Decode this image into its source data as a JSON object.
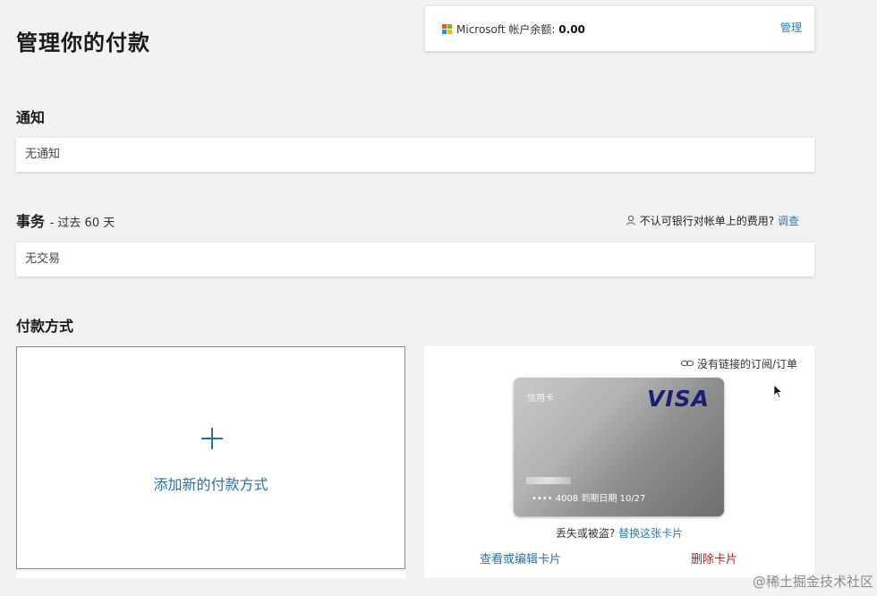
{
  "header": {
    "title": "管理你的付款"
  },
  "balance": {
    "label": "Microsoft 帐户余额:",
    "value": "0.00",
    "manage": "管理"
  },
  "notifications": {
    "heading": "通知",
    "empty": "无通知"
  },
  "transactions": {
    "heading": "事务",
    "subheading": "- 过去 60 天",
    "dispute_text": "不认可银行对帐单上的费用?",
    "dispute_link": "调查",
    "empty": "无交易"
  },
  "payment_methods": {
    "heading": "付款方式",
    "add_label": "添加新的付款方式",
    "card": {
      "linked_text": "没有链接的订阅/订单",
      "type_label": "信用卡",
      "brand": "VISA",
      "number": "•••• 4008 到期日期 10/27",
      "lost_text": "丢失或被盗?",
      "replace_link": "替换这张卡片",
      "view_edit": "查看或编辑卡片",
      "delete": "删除卡片"
    }
  },
  "watermark": "@稀土掘金技术社区",
  "colors": {
    "accent": "#2b6fa8",
    "danger": "#b22222",
    "visa_blue": "#1a1f71"
  }
}
